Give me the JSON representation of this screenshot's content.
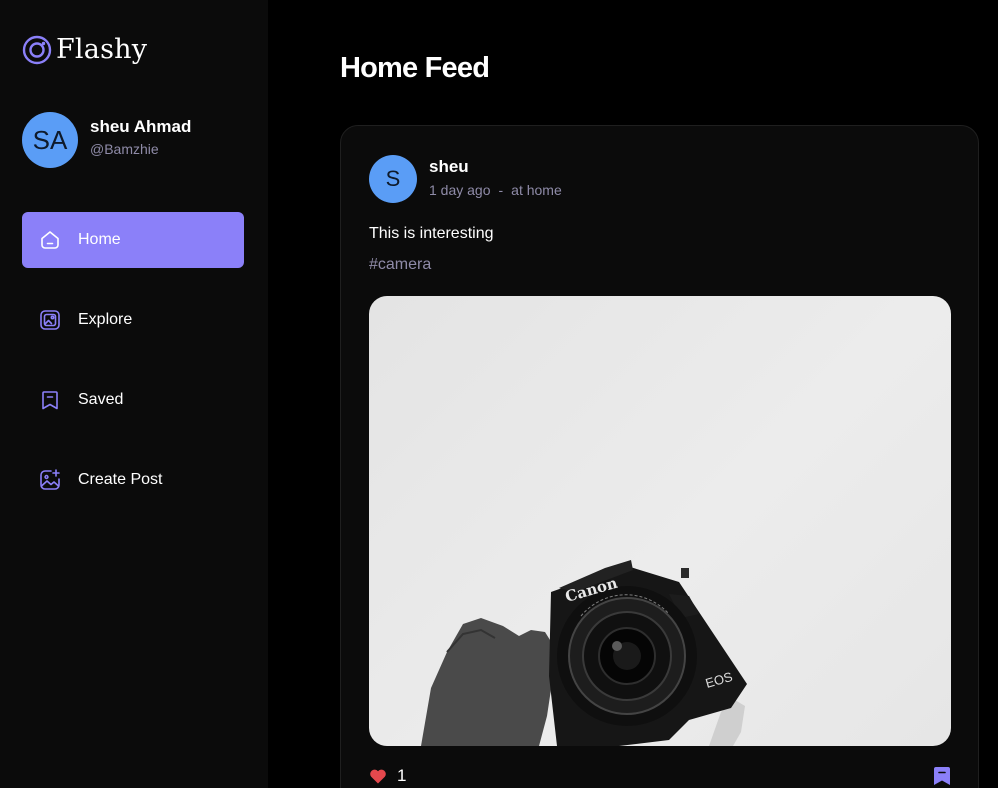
{
  "app": {
    "name": "Flashy"
  },
  "user": {
    "initials": "SA",
    "name": "sheu Ahmad",
    "handle": "@Bamzhie"
  },
  "nav": [
    {
      "label": "Home",
      "icon": "home-icon",
      "active": true
    },
    {
      "label": "Explore",
      "icon": "image-gallery-icon",
      "active": false
    },
    {
      "label": "Saved",
      "icon": "bookmark-icon",
      "active": false
    },
    {
      "label": "Create Post",
      "icon": "image-add-icon",
      "active": false
    }
  ],
  "page": {
    "title": "Home Feed"
  },
  "post": {
    "author_initial": "S",
    "author": "sheu",
    "time": "1 day ago",
    "separator": "-",
    "location": "at home",
    "text": "This is interesting",
    "tag": "#camera",
    "image_brand": "Canon",
    "image_model": "EOS",
    "like_count": "1"
  },
  "colors": {
    "accent": "#8b80f9",
    "avatar": "#5a9df6",
    "muted": "#8f8ba8",
    "like": "#e5484d",
    "sidebar": "#0b0b0b"
  }
}
